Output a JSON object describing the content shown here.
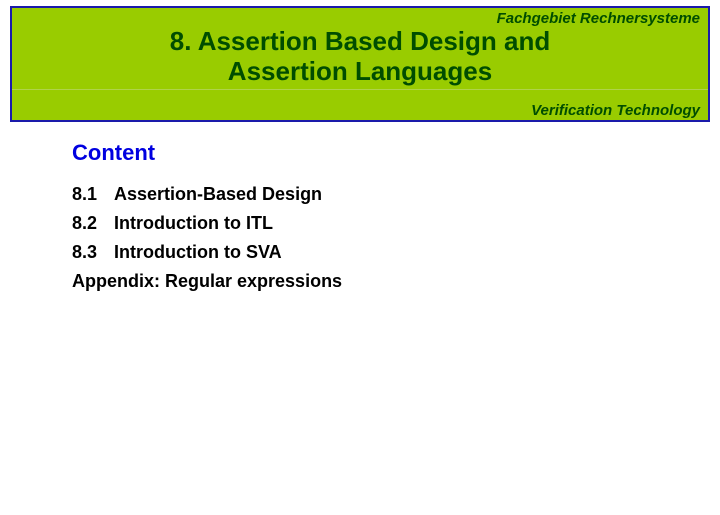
{
  "header": {
    "department": "Fachgebiet Rechnersysteme",
    "title_line1": "8. Assertion Based Design and",
    "title_line2": "Assertion Languages",
    "subject": "Verification Technology"
  },
  "content": {
    "heading": "Content",
    "items": [
      {
        "num": "8.1",
        "label": "Assertion-Based Design"
      },
      {
        "num": "8.2",
        "label": "Introduction to ITL"
      },
      {
        "num": "8.3",
        "label": "Introduction to SVA"
      },
      {
        "num": "",
        "label": "Appendix: Regular expressions"
      }
    ]
  }
}
